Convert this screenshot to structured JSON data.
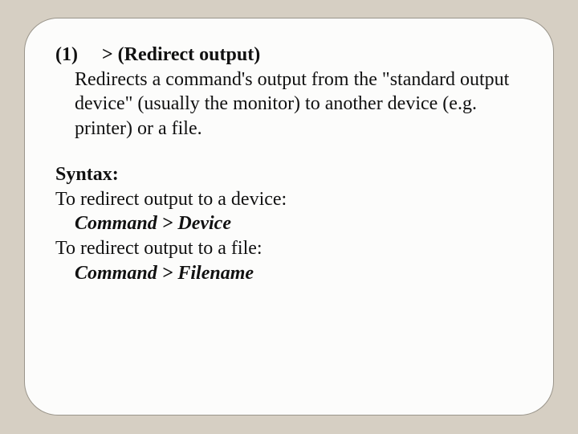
{
  "header": {
    "index": "(1)",
    "gap": "    ",
    "title": "> (Redirect output)"
  },
  "description": "Redirects a command's output from the \"standard output device\" (usually the monitor) to another device (e.g. printer) or a file.",
  "syntax": {
    "label": "Syntax:",
    "toDevice": {
      "text": "To redirect output to a device:",
      "command": "Command > Device"
    },
    "toFile": {
      "text": "To redirect output to a file:",
      "command": "Command > Filename"
    }
  }
}
